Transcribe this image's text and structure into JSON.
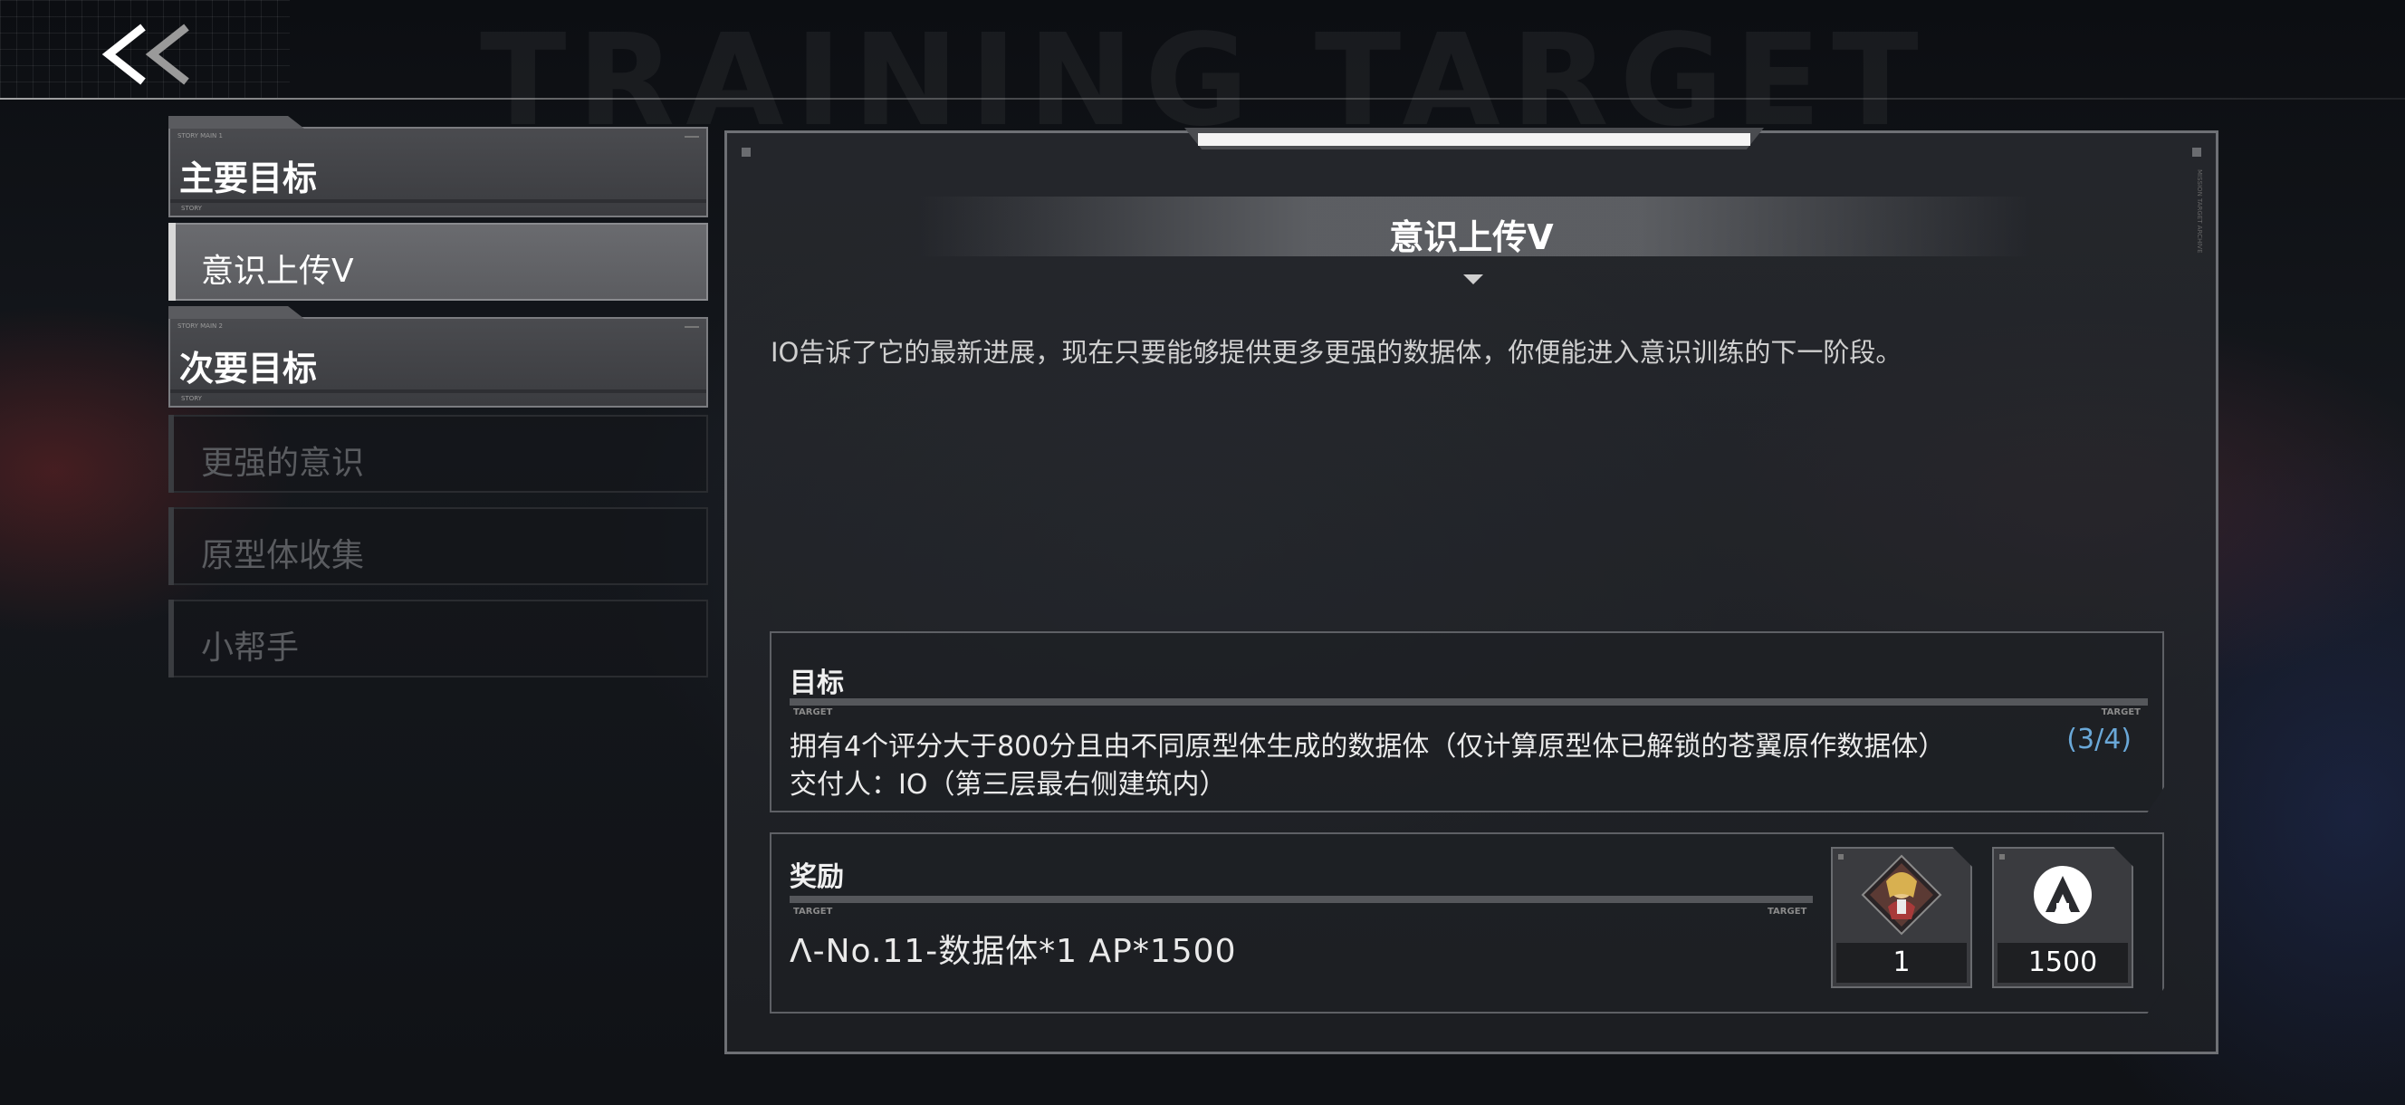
{
  "header": {
    "back_icon": "double-chevron-left-icon",
    "watermark": "TRAINING TARGET"
  },
  "sidebar": {
    "main_category": {
      "label": "主要目标",
      "micro_top": "STORY MAIN 1",
      "micro_bottom": "STORY"
    },
    "main_items": [
      {
        "label": "意识上传V",
        "active": true
      }
    ],
    "secondary_category": {
      "label": "次要目标",
      "micro_top": "STORY MAIN 2",
      "micro_bottom": "STORY"
    },
    "secondary_items": [
      {
        "label": "更强的意识",
        "active": false
      },
      {
        "label": "原型体收集",
        "active": false
      },
      {
        "label": "小帮手",
        "active": false
      }
    ]
  },
  "panel": {
    "side_micro": "MISSION TARGET ARCHIVE",
    "title": "意识上传V",
    "description": "IO告诉了它的最新进展，现在只要能够提供更多更强的数据体，你便能进入意识训练的下一阶段。",
    "objective": {
      "heading": "目标",
      "micro_left": "TARGET",
      "micro_right": "TARGET",
      "text": "拥有4个评分大于800分且由不同原型体生成的数据体（仅计算原型体已解锁的苍翼原作数据体）",
      "progress": "(3/4)",
      "deliver": "交付人：IO（第三层最右侧建筑内）"
    },
    "reward": {
      "heading": "奖励",
      "micro_left": "TARGET",
      "micro_right": "TARGET",
      "text": "Λ-No.11-数据体*1  AP*1500",
      "items": [
        {
          "icon": "character-portrait-icon",
          "count": "1"
        },
        {
          "icon": "ap-logo-icon",
          "count": "1500"
        }
      ]
    }
  },
  "colors": {
    "progress": "#6aa8d8",
    "active_item": "#5b5c60",
    "panel_border": "#6e7075"
  }
}
